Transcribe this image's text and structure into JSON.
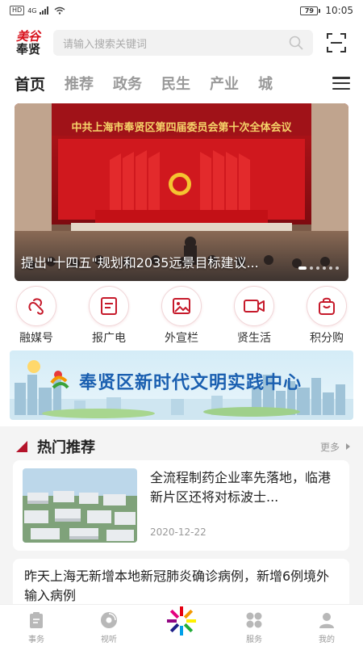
{
  "status_bar": {
    "hd": "HD",
    "network": "4G",
    "battery": "79",
    "time": "10:05"
  },
  "header": {
    "logo_top": "美谷",
    "logo_bottom": "奉贤",
    "search_placeholder": "请输入搜索关键词"
  },
  "tabs": [
    {
      "label": "首页",
      "active": true
    },
    {
      "label": "推荐"
    },
    {
      "label": "政务"
    },
    {
      "label": "民生"
    },
    {
      "label": "产业"
    },
    {
      "label": "城"
    }
  ],
  "banner": {
    "hall_title": "中共上海市奉贤区第四届委员会第十次全体会议",
    "caption": "提出\"十四五\"规划和2035远景目标建议...",
    "dots": 6,
    "active_dot": 0
  },
  "quick_links": [
    {
      "label": "融媒号",
      "icon": "link-loop-icon"
    },
    {
      "label": "报广电",
      "icon": "document-icon"
    },
    {
      "label": "外宣栏",
      "icon": "image-icon"
    },
    {
      "label": "贤生活",
      "icon": "video-camera-icon"
    },
    {
      "label": "积分购",
      "icon": "shopping-bag-icon"
    }
  ],
  "promo": {
    "text": "奉贤区新时代文明实践中心"
  },
  "hot": {
    "title": "热门推荐",
    "more": "更多"
  },
  "articles": [
    {
      "title": "全流程制药企业率先落地，临港新片区还将对标波士...",
      "date": "2020-12-22"
    },
    {
      "title": "昨天上海无新增本地新冠肺炎确诊病例，新增6例境外输入病例"
    }
  ],
  "bottom_nav": [
    {
      "label": "事务",
      "icon": "clipboard-icon"
    },
    {
      "label": "视听",
      "icon": "disc-icon"
    },
    {
      "label": "",
      "icon": "brand-star-icon"
    },
    {
      "label": "服务",
      "icon": "grid-icon"
    },
    {
      "label": "我的",
      "icon": "user-icon"
    }
  ],
  "colors": {
    "brand_red": "#d8101b",
    "accent_dark_red": "#b4132a",
    "promo_blue": "#1a5fb0"
  }
}
